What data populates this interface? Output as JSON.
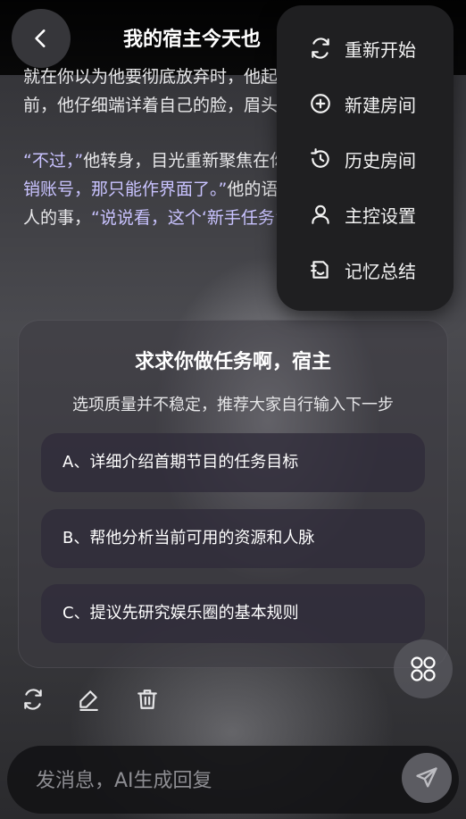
{
  "header": {
    "title": "我的宿主今天也"
  },
  "story": {
    "paragraph1": "就在你以为他要彻底放弃时，他起身走向浴室。镜子前，他仔细端详着自己的脸，眉头微蹙。",
    "p2_quote1": "“不过，”",
    "p2_text1": "他转身，目光重新聚焦在你，",
    "p2_quote2": "“既然暂时无法注销账号，那只能作界面了。”",
    "p2_text2": "他的语气平静得像在谈论别人的事，",
    "p2_quote3": "“说说看，这个‘新手任务’的"
  },
  "task_card": {
    "title": "求求你做任务啊，宿主",
    "subtitle": "选项质量并不稳定，推荐大家自行输入下一步",
    "options": [
      {
        "label": "A、详细介绍首期节目的任务目标"
      },
      {
        "label": "B、帮他分析当前可用的资源和人脉"
      },
      {
        "label": "C、提议先研究娱乐圈的基本规则"
      }
    ]
  },
  "composer": {
    "placeholder": "发消息，AI生成回复"
  },
  "menu": {
    "items": [
      {
        "label": "重新开始",
        "icon": "refresh-icon"
      },
      {
        "label": "新建房间",
        "icon": "plus-circle-icon"
      },
      {
        "label": "历史房间",
        "icon": "history-icon"
      },
      {
        "label": "主控设置",
        "icon": "user-icon"
      },
      {
        "label": "记忆总结",
        "icon": "memory-icon"
      }
    ]
  },
  "colors": {
    "quote": "#c9c3ff",
    "menu_bg": "#1f1f21"
  }
}
